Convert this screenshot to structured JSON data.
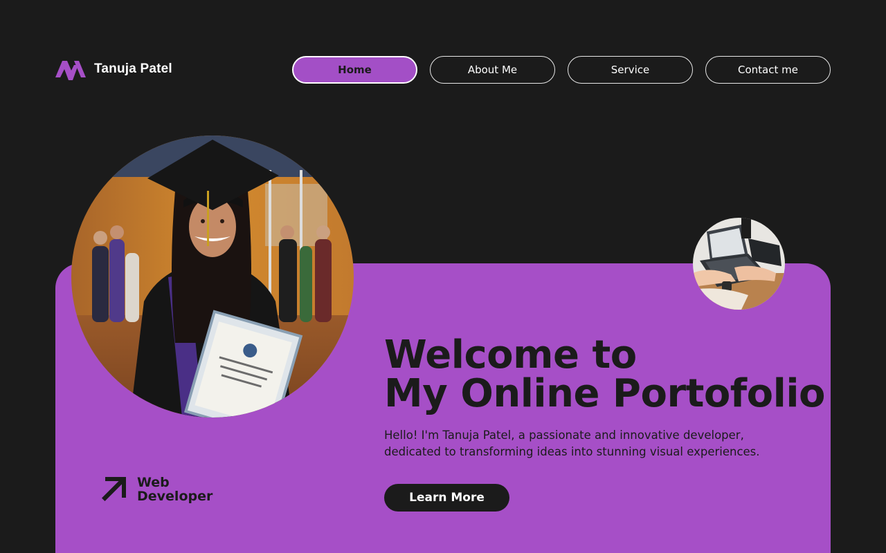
{
  "brand": {
    "name": "Tanuja Patel",
    "logo_icon": "m-logo-icon"
  },
  "nav": {
    "items": [
      {
        "label": "Home",
        "active": true
      },
      {
        "label": "About Me",
        "active": false
      },
      {
        "label": "Service",
        "active": false
      },
      {
        "label": "Contact me",
        "active": false
      }
    ]
  },
  "hero": {
    "title_line1": "Welcome to",
    "title_line2": "My Online Portofolio",
    "description_line1": "Hello! I'm  Tanuja Patel, a passionate and innovative developer,",
    "description_line2": "dedicated to transforming ideas into stunning visual experiences.",
    "cta_label": "Learn More"
  },
  "role": {
    "line1": "Web",
    "line2": "Developer",
    "icon": "arrow-up-right-icon"
  },
  "colors": {
    "background": "#1b1b1b",
    "accent": "#a64fc7",
    "text_dark": "#1b1b1b",
    "text_light": "#ffffff"
  }
}
